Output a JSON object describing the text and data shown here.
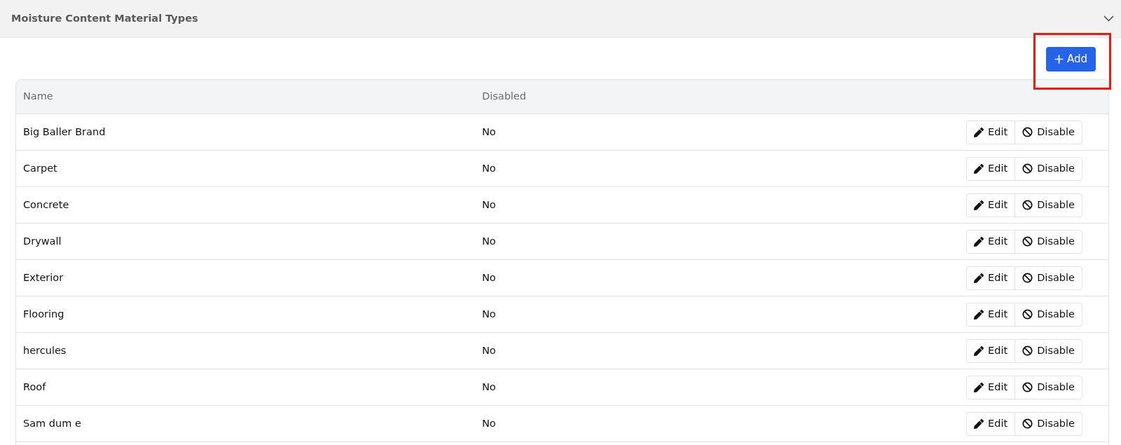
{
  "section": {
    "title": "Moisture Content Material Types",
    "expanded": true
  },
  "add_button": {
    "label": "Add",
    "highlighted": true
  },
  "table": {
    "columns": [
      "Name",
      "Disabled"
    ],
    "rows": [
      {
        "name": "Big Baller Brand",
        "disabled": "No",
        "actions": [
          {
            "kind": "edit",
            "label": "Edit"
          },
          {
            "kind": "disable",
            "label": "Disable"
          }
        ]
      },
      {
        "name": "Carpet",
        "disabled": "No",
        "actions": [
          {
            "kind": "edit",
            "label": "Edit"
          },
          {
            "kind": "disable",
            "label": "Disable"
          }
        ]
      },
      {
        "name": "Concrete",
        "disabled": "No",
        "actions": [
          {
            "kind": "edit",
            "label": "Edit"
          },
          {
            "kind": "disable",
            "label": "Disable"
          }
        ]
      },
      {
        "name": "Drywall",
        "disabled": "No",
        "actions": [
          {
            "kind": "edit",
            "label": "Edit"
          },
          {
            "kind": "disable",
            "label": "Disable"
          }
        ]
      },
      {
        "name": "Exterior",
        "disabled": "No",
        "actions": [
          {
            "kind": "edit",
            "label": "Edit"
          },
          {
            "kind": "disable",
            "label": "Disable"
          }
        ]
      },
      {
        "name": "Flooring",
        "disabled": "No",
        "actions": [
          {
            "kind": "edit",
            "label": "Edit"
          },
          {
            "kind": "disable",
            "label": "Disable"
          }
        ]
      },
      {
        "name": "hercules",
        "disabled": "No",
        "actions": [
          {
            "kind": "edit",
            "label": "Edit"
          },
          {
            "kind": "disable",
            "label": "Disable"
          }
        ]
      },
      {
        "name": "Roof",
        "disabled": "No",
        "actions": [
          {
            "kind": "edit",
            "label": "Edit"
          },
          {
            "kind": "disable",
            "label": "Disable"
          }
        ]
      },
      {
        "name": "Sam dum e",
        "disabled": "No",
        "actions": [
          {
            "kind": "edit",
            "label": "Edit"
          },
          {
            "kind": "disable",
            "label": "Disable"
          }
        ]
      }
    ]
  }
}
